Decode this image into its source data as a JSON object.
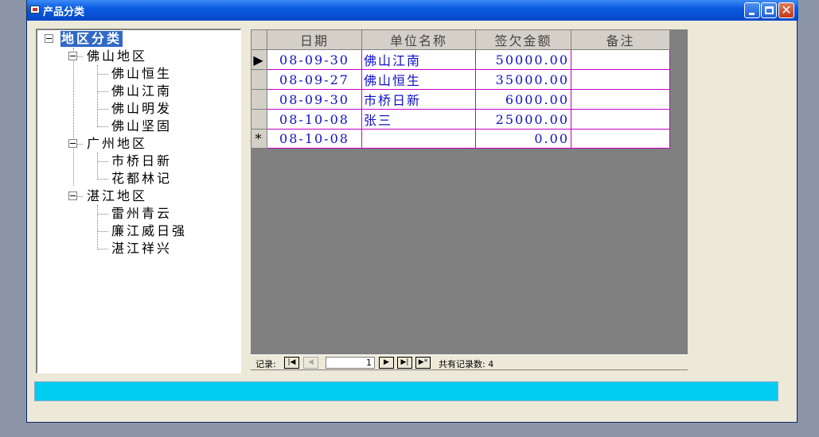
{
  "window": {
    "title": "产品分类",
    "controls": {
      "minimize": "minimize-icon",
      "maximize": "maximize-icon",
      "close": "✕"
    }
  },
  "tree": {
    "root": "地区分类",
    "groups": [
      {
        "label": "佛山地区",
        "children": [
          "佛山恒生",
          "佛山江南",
          "佛山明发",
          "佛山坚固"
        ]
      },
      {
        "label": "广州地区",
        "children": [
          "市桥日新",
          "花都林记"
        ]
      },
      {
        "label": "湛江地区",
        "children": [
          "雷州青云",
          "廉江威日强",
          "湛江祥兴"
        ]
      }
    ]
  },
  "grid": {
    "columns": [
      "日期",
      "单位名称",
      "签欠金额",
      "备注"
    ],
    "rows": [
      {
        "marker": "▶",
        "date": "08-09-30",
        "unit": "佛山江南",
        "amount": "50000.00",
        "note": ""
      },
      {
        "marker": "",
        "date": "08-09-27",
        "unit": "佛山恒生",
        "amount": "35000.00",
        "note": ""
      },
      {
        "marker": "",
        "date": "08-09-30",
        "unit": "市桥日新",
        "amount": "6000.00",
        "note": ""
      },
      {
        "marker": "",
        "date": "08-10-08",
        "unit": "张三",
        "amount": "25000.00",
        "note": ""
      },
      {
        "marker": "*",
        "date": "08-10-08",
        "unit": "",
        "amount": "0.00",
        "note": ""
      }
    ]
  },
  "navigator": {
    "label": "记录:",
    "current": "1",
    "first": "|◀",
    "prev": "◀",
    "next": "▶",
    "last": "▶|",
    "new": "▶*",
    "total_label": "共有记录数: 4"
  },
  "colors": {
    "title_bar": "#0a5be0",
    "status_bar": "#00ccf0",
    "grid_border": "#c600c6",
    "cell_text": "#1010c8",
    "selected_node": "#3169c6"
  }
}
